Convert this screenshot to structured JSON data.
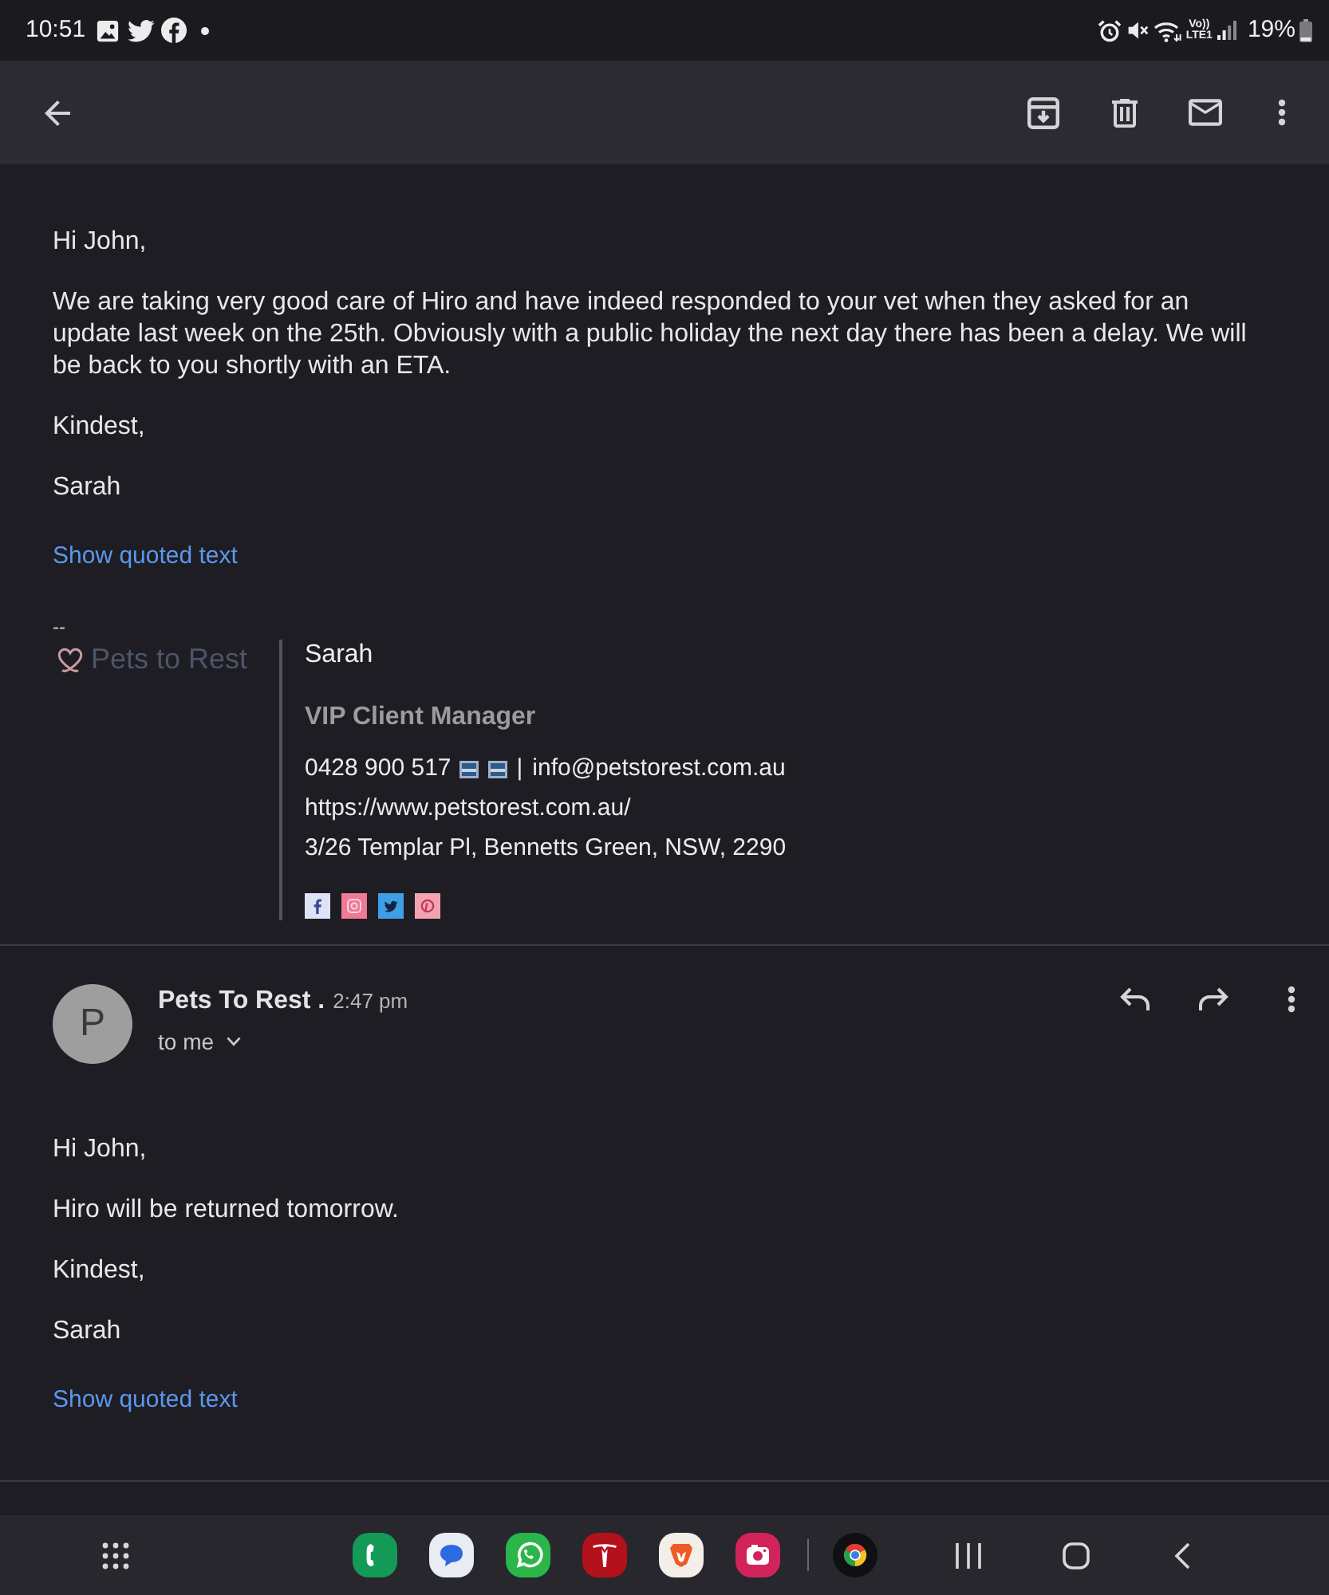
{
  "status_bar": {
    "time": "10:51",
    "network_label": [
      "Vo))",
      "LTE1"
    ],
    "battery": "19%"
  },
  "thread": [
    {
      "kind": "continued",
      "paragraphs": [
        "Hi John,",
        "We are taking very good care of Hiro and have indeed responded to your vet when they asked for an update last week on the 25th. Obviously with a public holiday the next day there has been a delay. We will be back to you shortly with an ETA.",
        "Kindest,",
        "Sarah"
      ],
      "quoted_link": "Show quoted text",
      "signature": {
        "separator": "--",
        "logo_text": "Pets to Rest",
        "name": "Sarah",
        "title": "VIP Client Manager",
        "phone": "0428 900 517",
        "divider": "|",
        "email": "info@petstorest.com.au",
        "website": "https://www.petstorest.com.au/",
        "address": "3/26 Templar Pl, Bennetts Green, NSW, 2290"
      }
    },
    {
      "kind": "message",
      "avatar_letter": "P",
      "sender": "Pets To Rest .",
      "time": "2:47 pm",
      "recipient": "to me",
      "paragraphs": [
        "Hi John,",
        "Hiro will be returned tomorrow.",
        "Kindest,",
        "Sarah"
      ],
      "quoted_link": "Show quoted text"
    }
  ]
}
